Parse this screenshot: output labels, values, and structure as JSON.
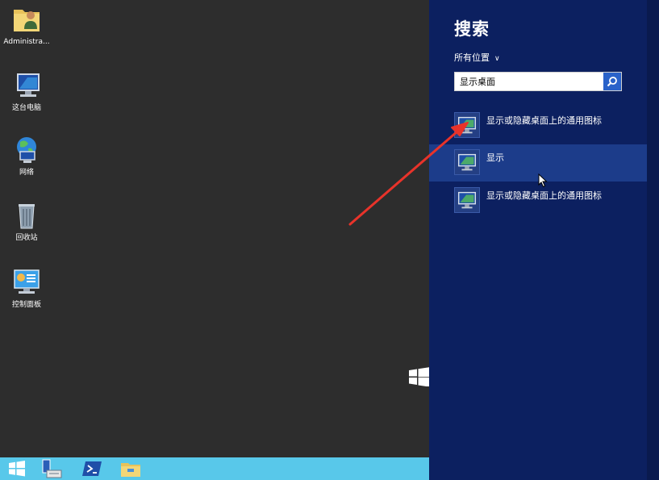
{
  "desktop": {
    "icons": [
      {
        "name": "administrator-folder",
        "label": "Administra..."
      },
      {
        "name": "this-pc",
        "label": "这台电脑"
      },
      {
        "name": "network",
        "label": "网络"
      },
      {
        "name": "recycle-bin",
        "label": "回收站"
      },
      {
        "name": "control-panel",
        "label": "控制面板"
      }
    ]
  },
  "taskbar": {
    "items": [
      "start-icon",
      "server-manager-icon",
      "powershell-icon",
      "file-explorer-icon"
    ],
    "color": "#58c8ea"
  },
  "search_charm": {
    "title": "搜索",
    "scope": "所有位置",
    "query": "显示桌面",
    "results": [
      {
        "label": "显示或隐藏桌面上的通用图标",
        "icon": "display-settings-icon"
      },
      {
        "label": "显示",
        "icon": "display-icon"
      },
      {
        "label": "显示或隐藏桌面上的通用图标",
        "icon": "display-settings-icon"
      }
    ],
    "bg_color": "#0c2060",
    "highlight_color": "#1c3c8a"
  },
  "annotation": {
    "color": "#e8332a"
  }
}
